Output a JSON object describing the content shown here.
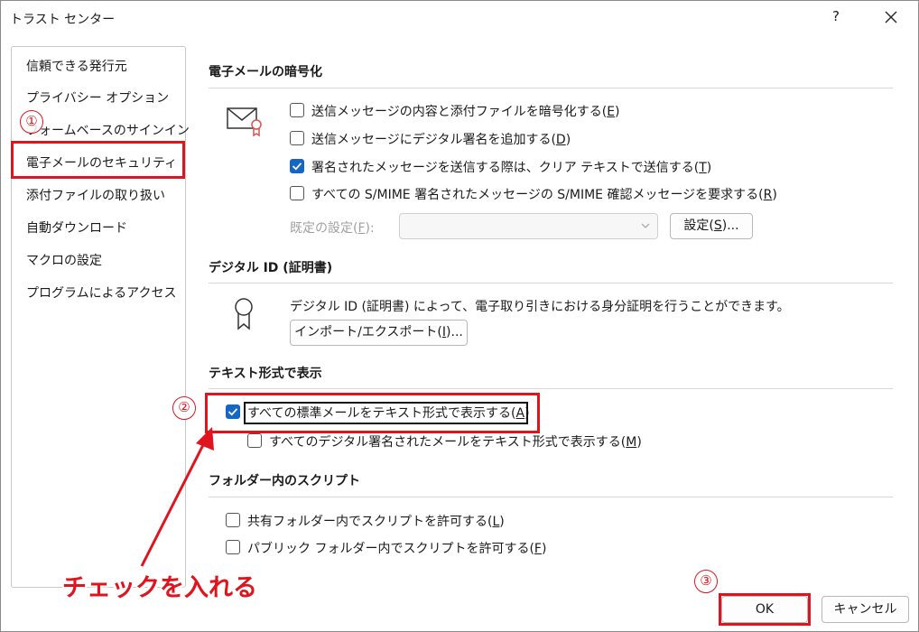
{
  "window": {
    "title": "トラスト センター",
    "help": "?"
  },
  "sidebar": {
    "items": [
      {
        "label": "信頼できる発行元"
      },
      {
        "label": "プライバシー オプション"
      },
      {
        "label": "フォームベースのサインイン"
      },
      {
        "label": "電子メールのセキュリティ"
      },
      {
        "label": "添付ファイルの取り扱い"
      },
      {
        "label": "自動ダウンロード"
      },
      {
        "label": "マクロの設定"
      },
      {
        "label": "プログラムによるアクセス"
      }
    ]
  },
  "encryption": {
    "title": "電子メールの暗号化",
    "options": [
      {
        "pre": "送信メッセージの内容と添付ファイルを暗号化する(",
        "key": "E",
        "post": ")",
        "checked": false
      },
      {
        "pre": "送信メッセージにデジタル署名を追加する(",
        "key": "D",
        "post": ")",
        "checked": false
      },
      {
        "pre": "署名されたメッセージを送信する際は、クリア テキストで送信する(",
        "key": "T",
        "post": ")",
        "checked": true
      },
      {
        "pre": "すべての S/MIME 署名されたメッセージの S/MIME 確認メッセージを要求する(",
        "key": "R",
        "post": ")",
        "checked": false
      }
    ],
    "default_setting": {
      "pre": "既定の設定(",
      "key": "F",
      "post": "):",
      "value": ""
    },
    "settings_button": {
      "pre": "設定(",
      "key": "S",
      "post": ")..."
    }
  },
  "digital_id": {
    "title": "デジタル ID (証明書)",
    "description": "デジタル ID (証明書) によって、電子取り引きにおける身分証明を行うことができます。",
    "button": {
      "pre": "インポート/エクスポート(",
      "key": "I",
      "post": ")..."
    }
  },
  "plain_text": {
    "title": "テキスト形式で表示",
    "options": [
      {
        "pre": "すべての標準メールをテキスト形式で表示する(",
        "key": "A",
        "post": ")",
        "checked": true
      },
      {
        "pre": "すべてのデジタル署名されたメールをテキスト形式で表示する(",
        "key": "M",
        "post": ")",
        "checked": false
      }
    ]
  },
  "folder_scripts": {
    "title": "フォルダー内のスクリプト",
    "options": [
      {
        "pre": "共有フォルダー内でスクリプトを許可する(",
        "key": "L",
        "post": ")",
        "checked": false
      },
      {
        "pre": "パブリック フォルダー内でスクリプトを許可する(",
        "key": "F",
        "post": ")",
        "checked": false
      }
    ]
  },
  "footer": {
    "ok": "OK",
    "cancel": "キャンセル"
  },
  "annotations": {
    "step1": "①",
    "step2": "②",
    "step3": "③",
    "callout": "チェックを入れる",
    "highlight_color": "#e0141e"
  }
}
